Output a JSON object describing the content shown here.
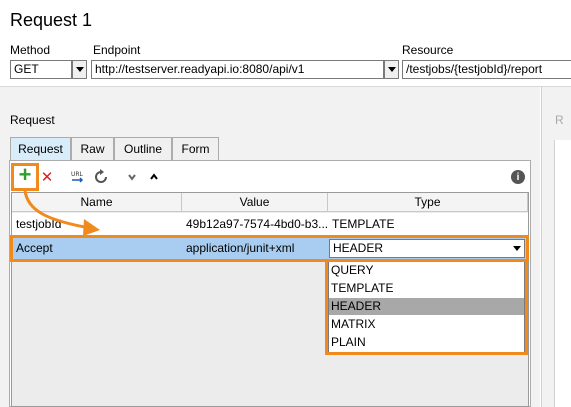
{
  "title": "Request 1",
  "labels": {
    "method": "Method",
    "endpoint": "Endpoint",
    "resource": "Resource"
  },
  "method": {
    "value": "GET"
  },
  "endpoint": {
    "value": "http://testserver.readyapi.io:8080/api/v1"
  },
  "resource": {
    "value": "/testjobs/{testjobId}/report"
  },
  "request_panel_label": "Request",
  "right_panel_label": "R",
  "tabs": [
    {
      "label": "Request",
      "active": true
    },
    {
      "label": "Raw"
    },
    {
      "label": "Outline"
    },
    {
      "label": "Form"
    }
  ],
  "toolbar": {
    "add": "+",
    "remove": "✕",
    "info": "i",
    "icons": [
      "add-icon",
      "delete-icon",
      "url-icon",
      "refresh-icon",
      "move-down-icon",
      "move-up-icon",
      "info-icon"
    ]
  },
  "table": {
    "headers": [
      "Name",
      "Value",
      "Type"
    ],
    "rows": [
      {
        "name": "testjobId",
        "value": "49b12a97-7574-4bd0-b3...",
        "type": "TEMPLATE"
      },
      {
        "name": "Accept",
        "value": "application/junit+xml",
        "type": "HEADER"
      }
    ]
  },
  "type_dropdown": {
    "selected": "HEADER",
    "options": [
      "QUERY",
      "TEMPLATE",
      "HEADER",
      "MATRIX",
      "PLAIN"
    ]
  },
  "colors": {
    "highlight": "#f08a1c",
    "selected_row": "#a8cdf0",
    "active_tab": "#d9ecf9",
    "add_green": "#2e9e2e",
    "delete_red": "#e02020"
  }
}
